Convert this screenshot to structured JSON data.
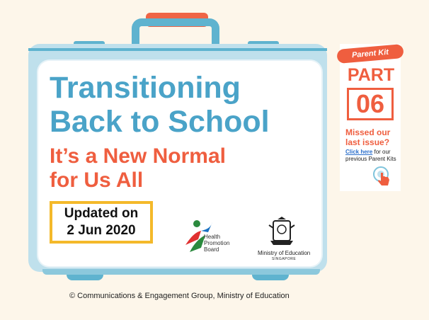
{
  "title": {
    "line1": "Transitioning",
    "line2": "Back to School"
  },
  "subtitle": {
    "line1": "It’s a New Normal",
    "line2": "for Us All"
  },
  "updated": {
    "line1": "Updated on",
    "line2": "2 Jun 2020"
  },
  "logos": {
    "hpb": {
      "line1": "Health",
      "line2": "Promotion",
      "line3": "Board"
    },
    "moe": {
      "name": "Ministry of Education",
      "sub": "SINGAPORE"
    }
  },
  "parent_kit": {
    "tag": "Parent Kit",
    "part_label": "PART",
    "part_number": "06",
    "missed": "Missed our last issue?",
    "link_text": "Click here",
    "link_suffix": " for our previous Parent Kits"
  },
  "footer": {
    "copyright": "© Communications & Engagement Group, Ministry of Education"
  },
  "colors": {
    "background": "#fdf6ea",
    "case_blue": "#5fb3cf",
    "case_light": "#bfe0ec",
    "title_blue": "#4aa3c8",
    "accent_orange": "#ef5e3f",
    "highlight_yellow": "#f4b92a"
  },
  "icons": {
    "hpb_logo": "hpb-figure-icon",
    "moe_crest": "moe-crest-icon",
    "click": "hand-pointer-icon"
  }
}
